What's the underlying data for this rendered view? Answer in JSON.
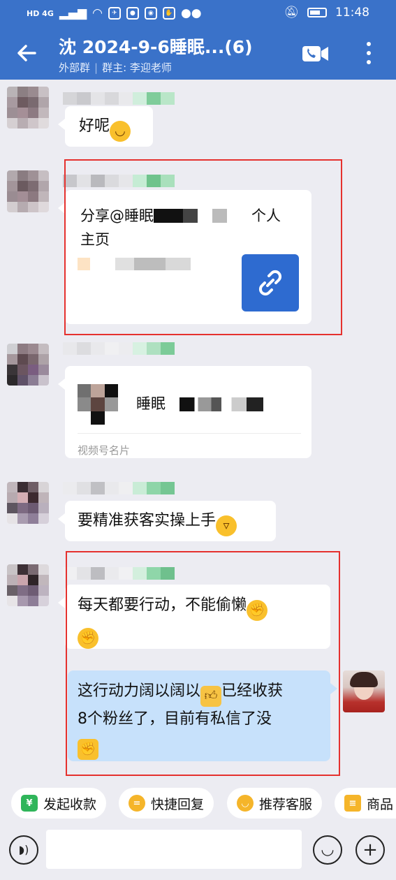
{
  "status_bar": {
    "network": "HD 4G",
    "time": "11:48"
  },
  "header": {
    "title": "沈 2024-9-6睡眠...(6)",
    "external_tag": "外部群",
    "owner_label": "群主: 李迎老师"
  },
  "messages": [
    {
      "type": "text",
      "text": "好呢",
      "emoji": "smile"
    },
    {
      "type": "link_card",
      "title_part1": "分享@睡眠",
      "title_part2": "个人",
      "title_part3": "主页"
    },
    {
      "type": "channel_card",
      "name": "睡眠",
      "footer": "视频号名片"
    },
    {
      "type": "text",
      "text": "要精准获客实操上手",
      "emoji": "grin"
    },
    {
      "type": "text",
      "text": "每天都要行动，不能偷懒",
      "emoji": "fight"
    },
    {
      "type": "text_mine",
      "line1": "这行动力阔以阔以",
      "line1b": "已经收获",
      "line2": "8个粉丝了，目前有私信了没",
      "emoji": "fist"
    }
  ],
  "quick_actions": [
    {
      "label": "发起收款",
      "icon": "yen-icon",
      "color": "#2fb55a"
    },
    {
      "label": "快捷回复",
      "icon": "quick-reply-icon",
      "color": "#f5b52a"
    },
    {
      "label": "推荐客服",
      "icon": "service-icon",
      "color": "#f5b52a"
    },
    {
      "label": "商品",
      "icon": "goods-icon",
      "color": "#f5b52a"
    }
  ],
  "input": {
    "placeholder": ""
  },
  "colors": {
    "header": "#3a72c9",
    "highlight_box": "#e5312e",
    "my_bubble": "#c7e1fb",
    "link_icon_bg": "#2e6bd0"
  }
}
